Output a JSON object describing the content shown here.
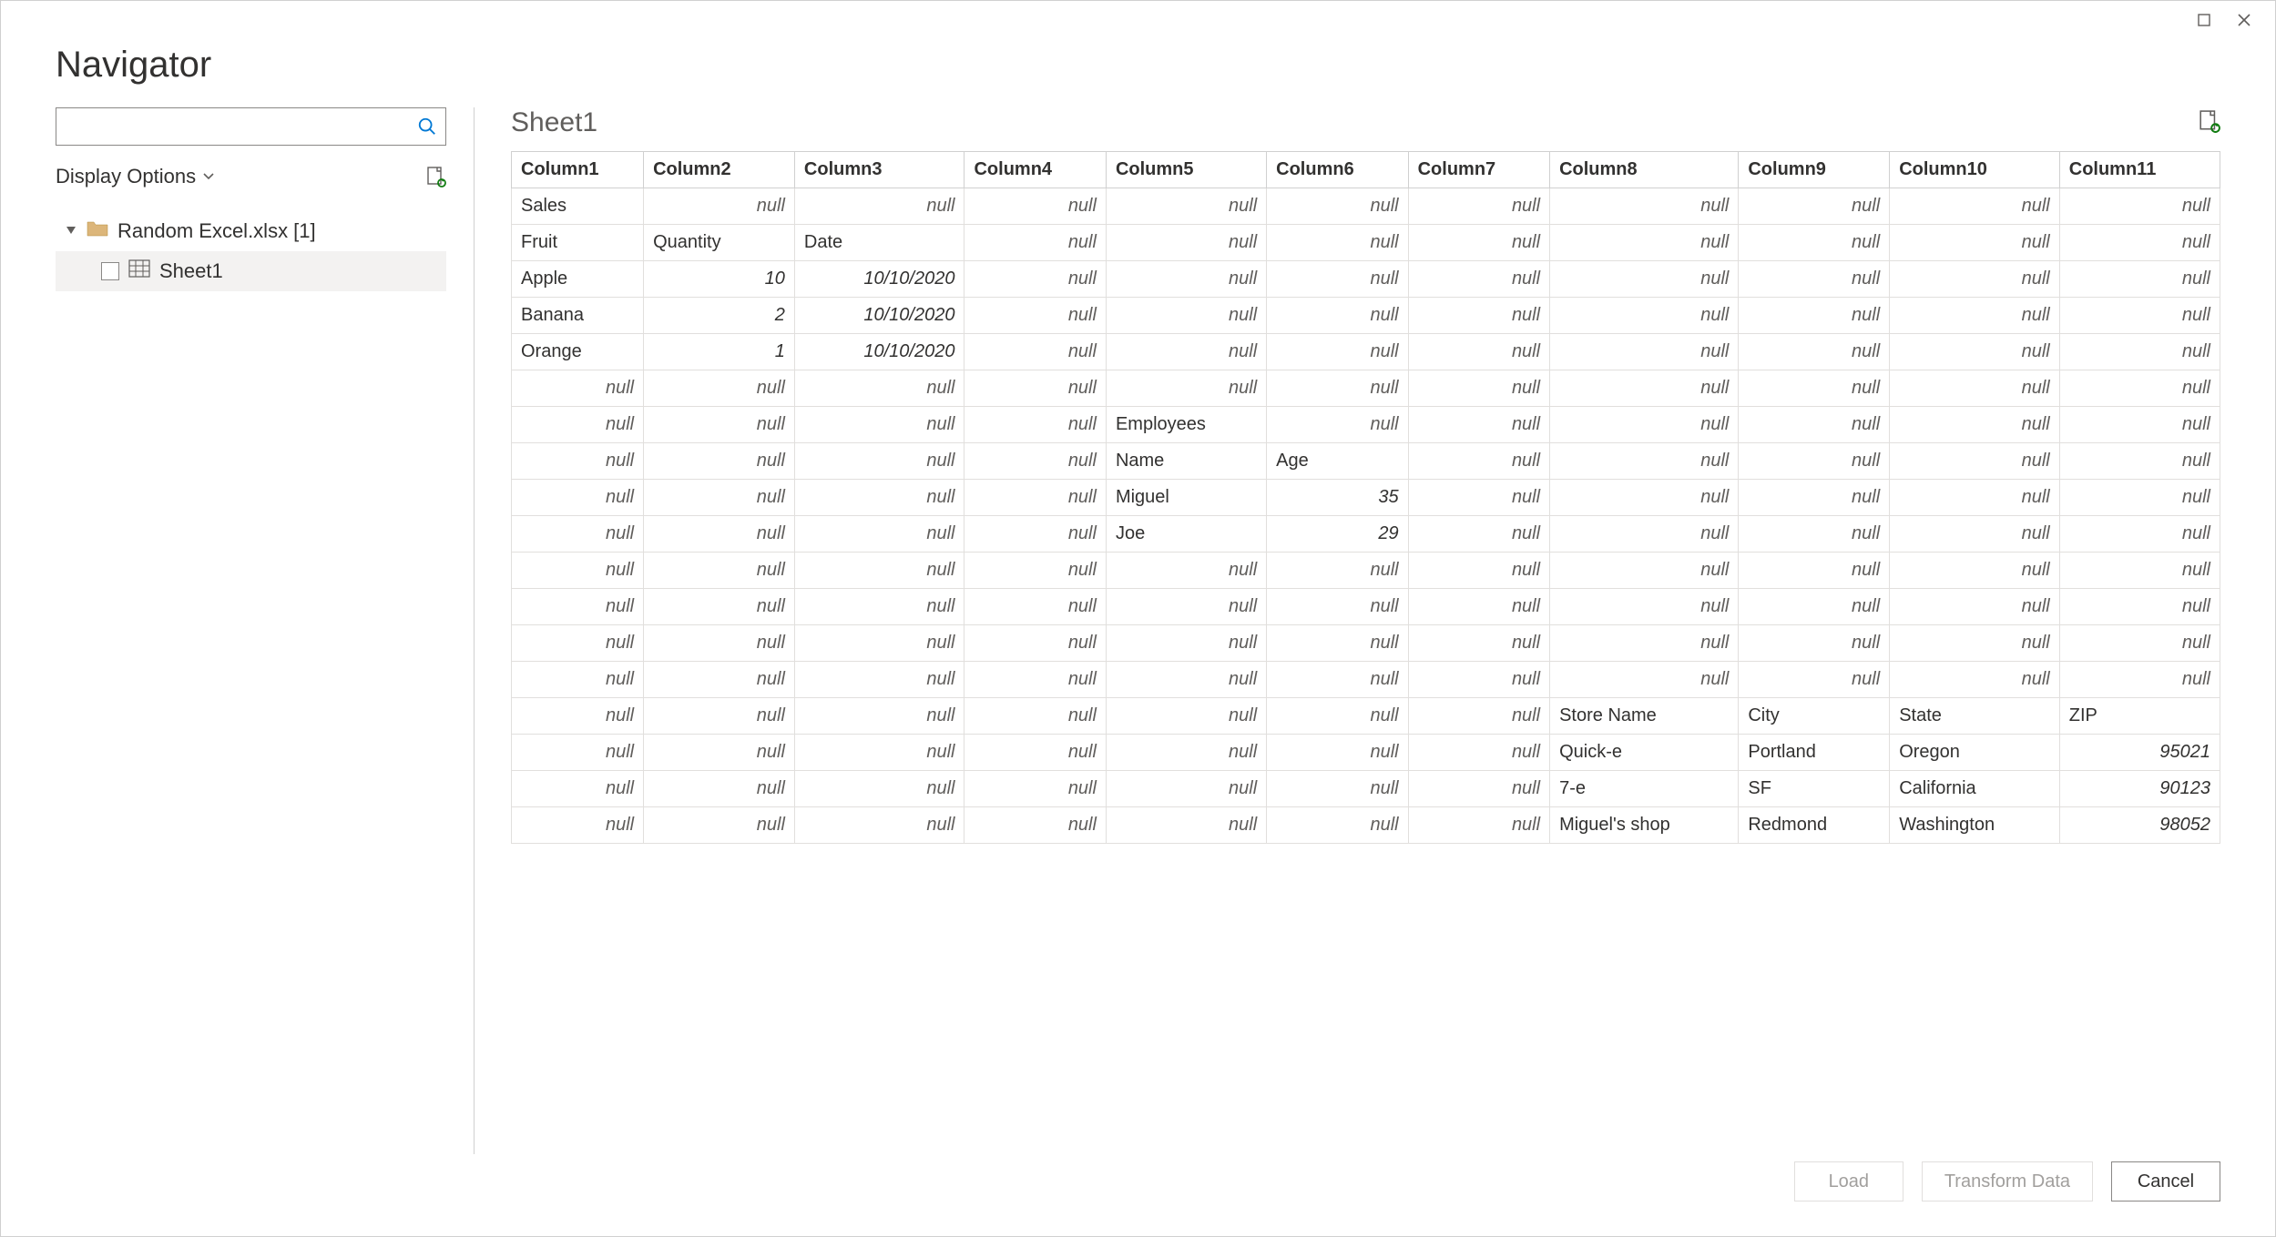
{
  "title": "Navigator",
  "left": {
    "display_options": "Display Options",
    "file_node": "Random Excel.xlsx [1]",
    "sheet_node": "Sheet1"
  },
  "right": {
    "title": "Sheet1"
  },
  "table": {
    "headers": [
      "Column1",
      "Column2",
      "Column3",
      "Column4",
      "Column5",
      "Column6",
      "Column7",
      "Column8",
      "Column9",
      "Column10",
      "Column11"
    ],
    "null_label": "null",
    "rows": [
      [
        {
          "v": "Sales",
          "t": "txt"
        },
        null,
        null,
        null,
        null,
        null,
        null,
        null,
        null,
        null,
        null
      ],
      [
        {
          "v": "Fruit",
          "t": "txt"
        },
        {
          "v": "Quantity",
          "t": "txt"
        },
        {
          "v": "Date",
          "t": "txt"
        },
        null,
        null,
        null,
        null,
        null,
        null,
        null,
        null
      ],
      [
        {
          "v": "Apple",
          "t": "txt"
        },
        {
          "v": "10",
          "t": "num"
        },
        {
          "v": "10/10/2020",
          "t": "date"
        },
        null,
        null,
        null,
        null,
        null,
        null,
        null,
        null
      ],
      [
        {
          "v": "Banana",
          "t": "txt"
        },
        {
          "v": "2",
          "t": "num"
        },
        {
          "v": "10/10/2020",
          "t": "date"
        },
        null,
        null,
        null,
        null,
        null,
        null,
        null,
        null
      ],
      [
        {
          "v": "Orange",
          "t": "txt"
        },
        {
          "v": "1",
          "t": "num"
        },
        {
          "v": "10/10/2020",
          "t": "date"
        },
        null,
        null,
        null,
        null,
        null,
        null,
        null,
        null
      ],
      [
        null,
        null,
        null,
        null,
        null,
        null,
        null,
        null,
        null,
        null,
        null
      ],
      [
        null,
        null,
        null,
        null,
        {
          "v": "Employees",
          "t": "txt"
        },
        null,
        null,
        null,
        null,
        null,
        null
      ],
      [
        null,
        null,
        null,
        null,
        {
          "v": "Name",
          "t": "txt"
        },
        {
          "v": "Age",
          "t": "txt"
        },
        null,
        null,
        null,
        null,
        null
      ],
      [
        null,
        null,
        null,
        null,
        {
          "v": "Miguel",
          "t": "txt"
        },
        {
          "v": "35",
          "t": "num"
        },
        null,
        null,
        null,
        null,
        null
      ],
      [
        null,
        null,
        null,
        null,
        {
          "v": "Joe",
          "t": "txt"
        },
        {
          "v": "29",
          "t": "num"
        },
        null,
        null,
        null,
        null,
        null
      ],
      [
        null,
        null,
        null,
        null,
        null,
        null,
        null,
        null,
        null,
        null,
        null
      ],
      [
        null,
        null,
        null,
        null,
        null,
        null,
        null,
        null,
        null,
        null,
        null
      ],
      [
        null,
        null,
        null,
        null,
        null,
        null,
        null,
        null,
        null,
        null,
        null
      ],
      [
        null,
        null,
        null,
        null,
        null,
        null,
        null,
        null,
        null,
        null,
        null
      ],
      [
        null,
        null,
        null,
        null,
        null,
        null,
        null,
        {
          "v": "Store Name",
          "t": "txt"
        },
        {
          "v": "City",
          "t": "txt"
        },
        {
          "v": "State",
          "t": "txt"
        },
        {
          "v": "ZIP",
          "t": "txt"
        }
      ],
      [
        null,
        null,
        null,
        null,
        null,
        null,
        null,
        {
          "v": "Quick-e",
          "t": "txt"
        },
        {
          "v": "Portland",
          "t": "txt"
        },
        {
          "v": "Oregon",
          "t": "txt"
        },
        {
          "v": "95021",
          "t": "num"
        }
      ],
      [
        null,
        null,
        null,
        null,
        null,
        null,
        null,
        {
          "v": "7-e",
          "t": "txt"
        },
        {
          "v": "SF",
          "t": "txt"
        },
        {
          "v": "California",
          "t": "txt"
        },
        {
          "v": "90123",
          "t": "num"
        }
      ],
      [
        null,
        null,
        null,
        null,
        null,
        null,
        null,
        {
          "v": "Miguel's shop",
          "t": "txt"
        },
        {
          "v": "Redmond",
          "t": "txt"
        },
        {
          "v": "Washington",
          "t": "txt"
        },
        {
          "v": "98052",
          "t": "num"
        }
      ]
    ]
  },
  "footer": {
    "load": "Load",
    "transform": "Transform Data",
    "cancel": "Cancel"
  }
}
